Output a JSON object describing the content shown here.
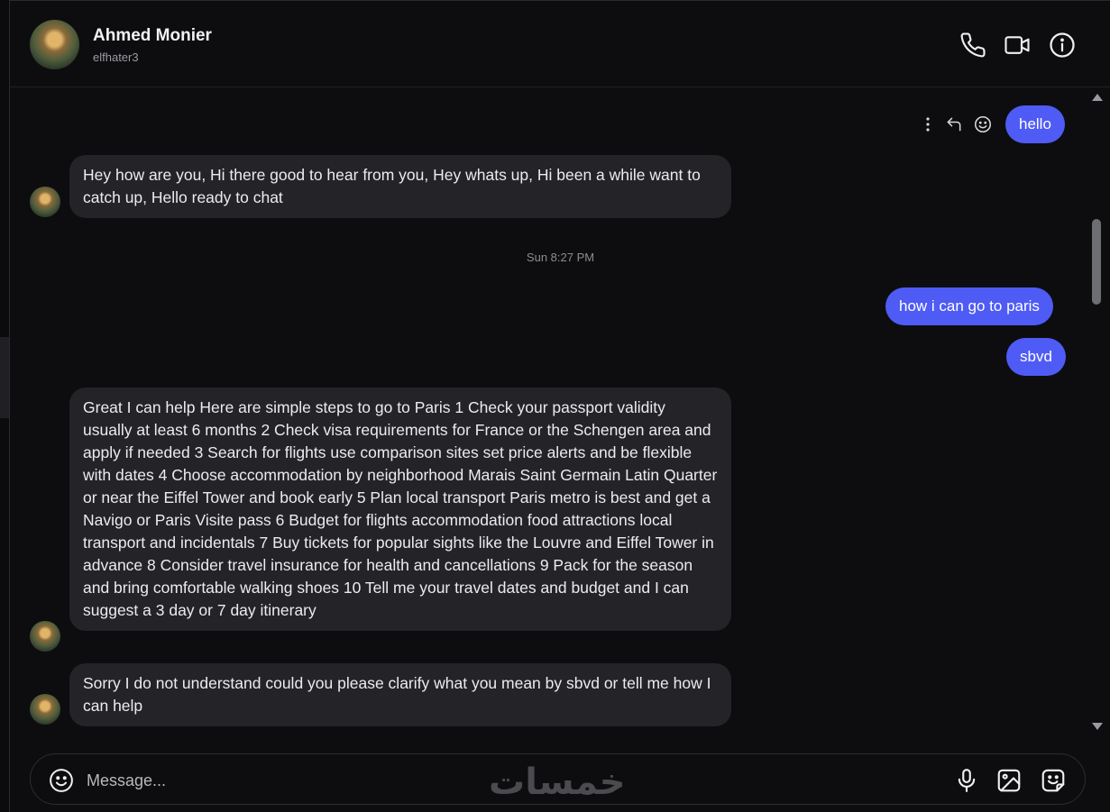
{
  "contact": {
    "name": "Ahmed Monier",
    "username": "elfhater3"
  },
  "header_icons": [
    "phone-icon",
    "video-icon",
    "info-icon"
  ],
  "timestamp": "Sun 8:27 PM",
  "messages": [
    {
      "direction": "out",
      "text": "hello"
    },
    {
      "direction": "in",
      "text": "Hey how are you, Hi there good to hear from you, Hey whats up, Hi been a while want to catch up, Hello ready to chat"
    },
    {
      "direction": "out",
      "text": "how i can go to paris"
    },
    {
      "direction": "out",
      "text": "sbvd"
    },
    {
      "direction": "in",
      "text": "Great I can help Here are simple steps to go to Paris 1 Check your passport validity usually at least 6 months 2 Check visa requirements for France or the Schengen area and apply if needed 3 Search for flights use comparison sites set price alerts and be flexible with dates 4 Choose accommodation by neighborhood Marais Saint Germain Latin Quarter or near the Eiffel Tower and book early 5 Plan local transport Paris metro is best and get a Navigo or Paris Visite pass 6 Budget for flights accommodation food attractions local transport and incidentals 7 Buy tickets for popular sights like the Louvre and Eiffel Tower in advance 8 Consider travel insurance for health and cancellations 9 Pack for the season and bring comfortable walking shoes 10 Tell me your travel dates and budget and I can suggest a 3 day or 7 day itinerary"
    },
    {
      "direction": "in",
      "text": "Sorry I do not understand could you please clarify what you mean by sbvd or tell me how I can help"
    }
  ],
  "composer": {
    "placeholder": "Message...",
    "watermark": "خمسات"
  },
  "colors": {
    "outgoing_bubble": "#4f5bf5",
    "incoming_bubble": "#242428",
    "background": "#0d0d0f"
  }
}
